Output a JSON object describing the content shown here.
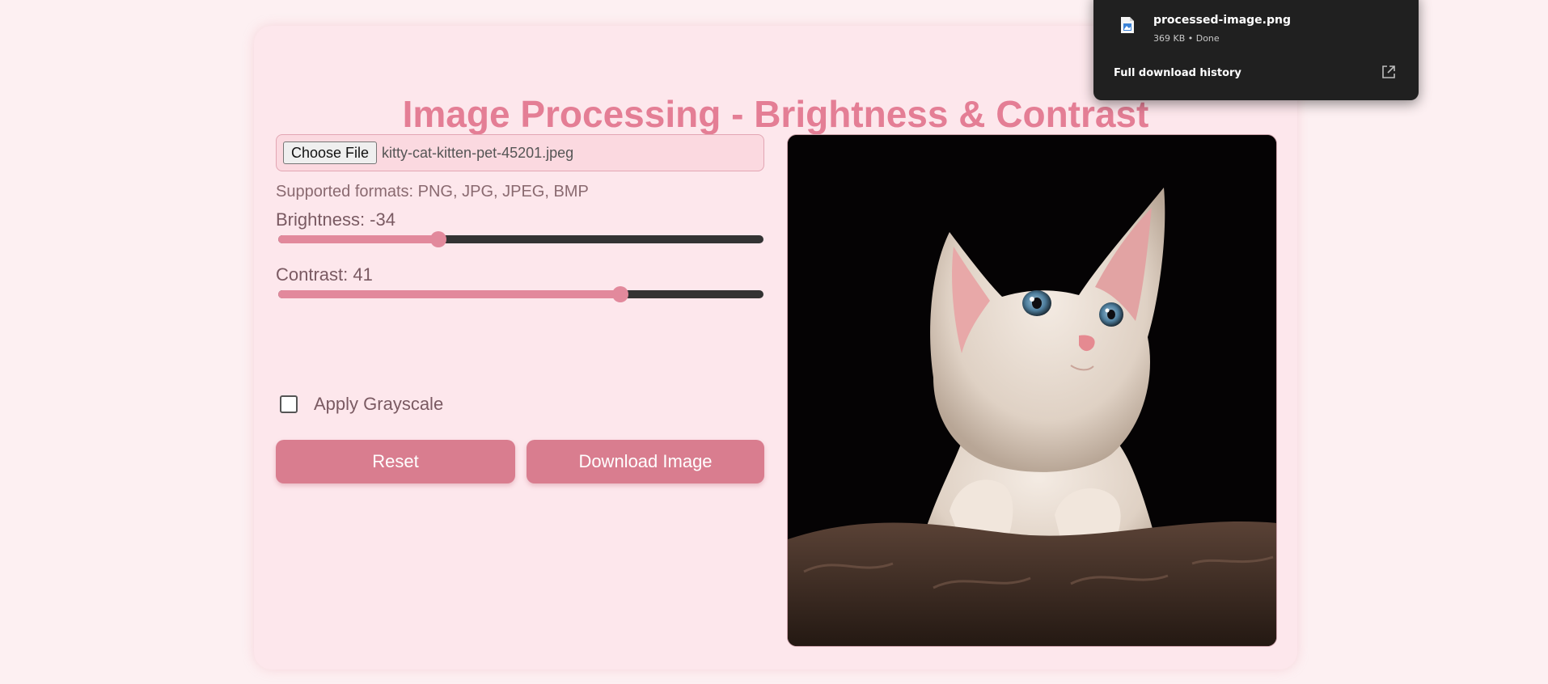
{
  "page": {
    "title": "Image Processing - Brightness & Contrast"
  },
  "file_input": {
    "button_label": "Choose File",
    "file_name": "kitty-cat-kitten-pet-45201.jpeg",
    "supported_formats": "Supported formats: PNG, JPG, JPEG, BMP"
  },
  "brightness": {
    "label": "Brightness: -34",
    "value": -34,
    "min": -100,
    "max": 100
  },
  "contrast": {
    "label": "Contrast: 41",
    "value": 41,
    "min": -100,
    "max": 100
  },
  "grayscale": {
    "label": "Apply Grayscale",
    "checked": false
  },
  "buttons": {
    "reset": "Reset",
    "download": "Download Image"
  },
  "download_popup": {
    "file_name": "processed-image.png",
    "status": "369 KB • Done",
    "history_link": "Full download history"
  },
  "colors": {
    "accent": "#e47e95",
    "button": "#d97d8f",
    "slider_fill": "#e2899c",
    "slider_track": "#333333",
    "page_background": "#fdf0f2",
    "card_background": "#fde7ec",
    "popup_background": "#202020"
  },
  "icons": {
    "file": "image-file-icon",
    "open_external": "open-external-icon"
  }
}
